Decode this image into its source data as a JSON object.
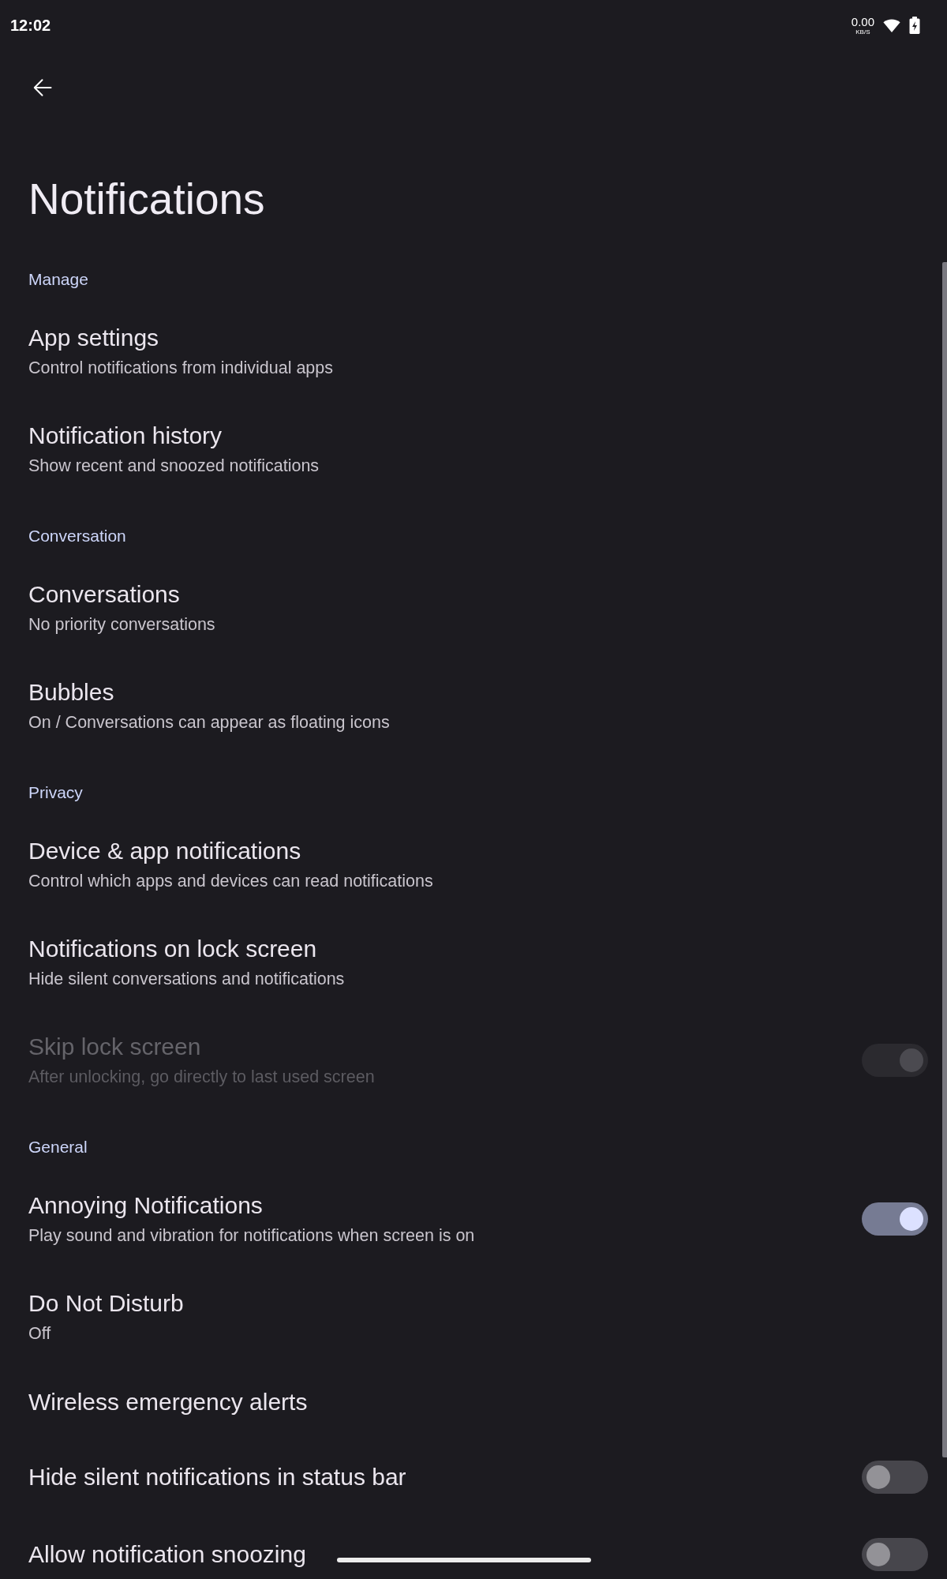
{
  "status_bar": {
    "time": "12:02",
    "net_speed": "0.00",
    "net_speed_unit": "KB/S"
  },
  "title": "Notifications",
  "sections": [
    {
      "header": "Manage",
      "items": [
        {
          "kind": "link",
          "title": "App settings",
          "summary": "Control notifications from individual apps",
          "disabled": false
        },
        {
          "kind": "link",
          "title": "Notification history",
          "summary": "Show recent and snoozed notifications",
          "disabled": false
        }
      ]
    },
    {
      "header": "Conversation",
      "items": [
        {
          "kind": "link",
          "title": "Conversations",
          "summary": "No priority conversations",
          "disabled": false
        },
        {
          "kind": "link",
          "title": "Bubbles",
          "summary": "On / Conversations can appear as floating icons",
          "disabled": false
        }
      ]
    },
    {
      "header": "Privacy",
      "items": [
        {
          "kind": "link",
          "title": "Device & app notifications",
          "summary": "Control which apps and devices can read notifications",
          "disabled": false
        },
        {
          "kind": "link",
          "title": "Notifications on lock screen",
          "summary": "Hide silent conversations and notifications",
          "disabled": false
        },
        {
          "kind": "switch",
          "title": "Skip lock screen",
          "summary": "After unlocking, go directly to last used screen",
          "disabled": true,
          "on": true
        }
      ]
    },
    {
      "header": "General",
      "items": [
        {
          "kind": "switch",
          "title": "Annoying Notifications",
          "summary": "Play sound and vibration for notifications when screen is on",
          "disabled": false,
          "on": true
        },
        {
          "kind": "link",
          "title": "Do Not Disturb",
          "summary": "Off",
          "disabled": false
        },
        {
          "kind": "link",
          "title": "Wireless emergency alerts",
          "disabled": false
        },
        {
          "kind": "switch",
          "title": "Hide silent notifications in status bar",
          "disabled": false,
          "on": false
        },
        {
          "kind": "switch",
          "title": "Allow notification snoozing",
          "disabled": false,
          "on": false
        }
      ]
    }
  ]
}
